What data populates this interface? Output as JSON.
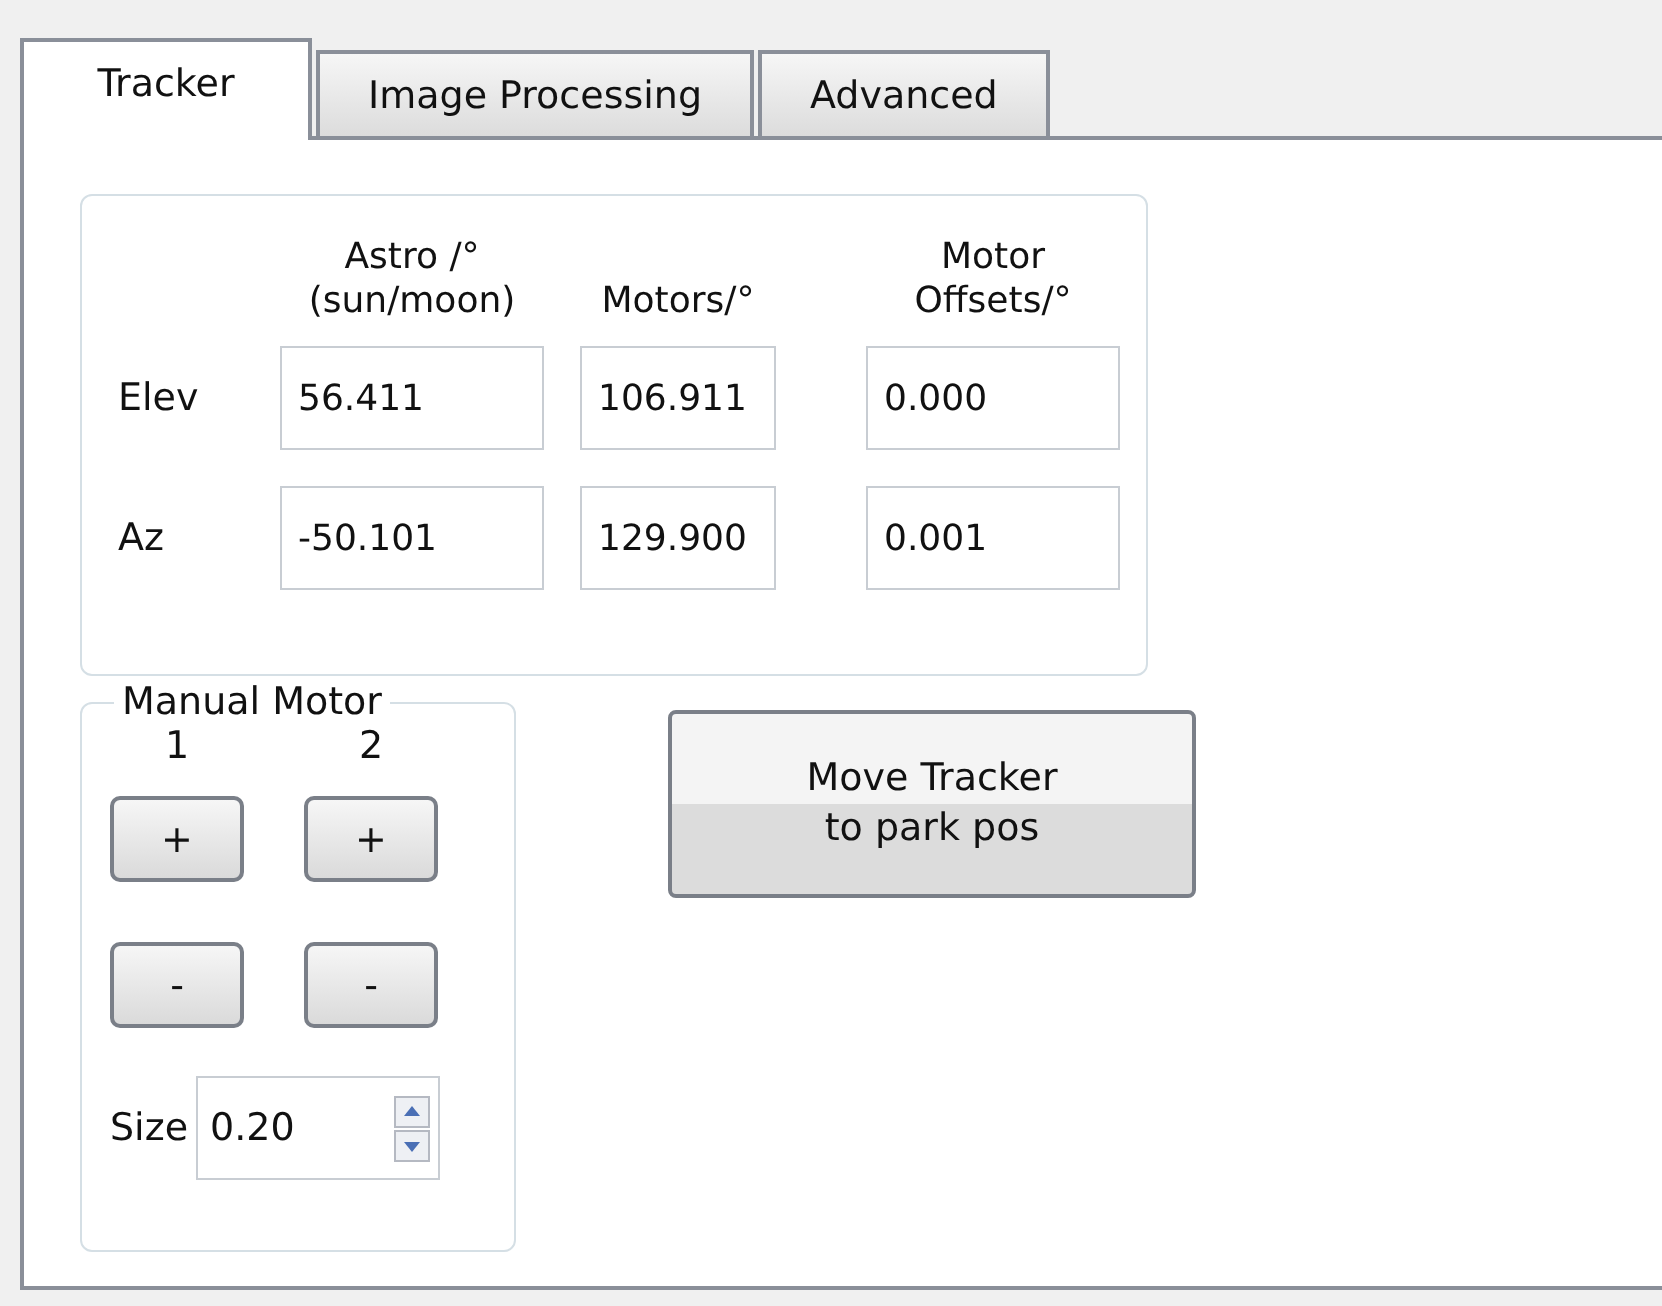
{
  "tabs": [
    {
      "label": "Tracker",
      "selected": true
    },
    {
      "label": "Image Processing",
      "selected": false
    },
    {
      "label": "Advanced",
      "selected": false
    }
  ],
  "position_table": {
    "columns": [
      "Astro /°\n(sun/moon)",
      "Motors/°",
      "Motor\nOffsets/°"
    ],
    "rows": [
      {
        "label": "Elev",
        "values": [
          "56.411",
          "106.911",
          "0.000"
        ]
      },
      {
        "label": "Az",
        "values": [
          "-50.101",
          "129.900",
          "0.001"
        ]
      }
    ]
  },
  "manual_motor": {
    "title": "Manual Motor",
    "motors": [
      {
        "label": "1",
        "buttons": [
          "+",
          "-"
        ]
      },
      {
        "label": "2",
        "buttons": [
          "+",
          "-"
        ]
      }
    ],
    "size": {
      "label": "Size",
      "value": "0.20"
    }
  },
  "park_button": "Move Tracker\nto park pos"
}
